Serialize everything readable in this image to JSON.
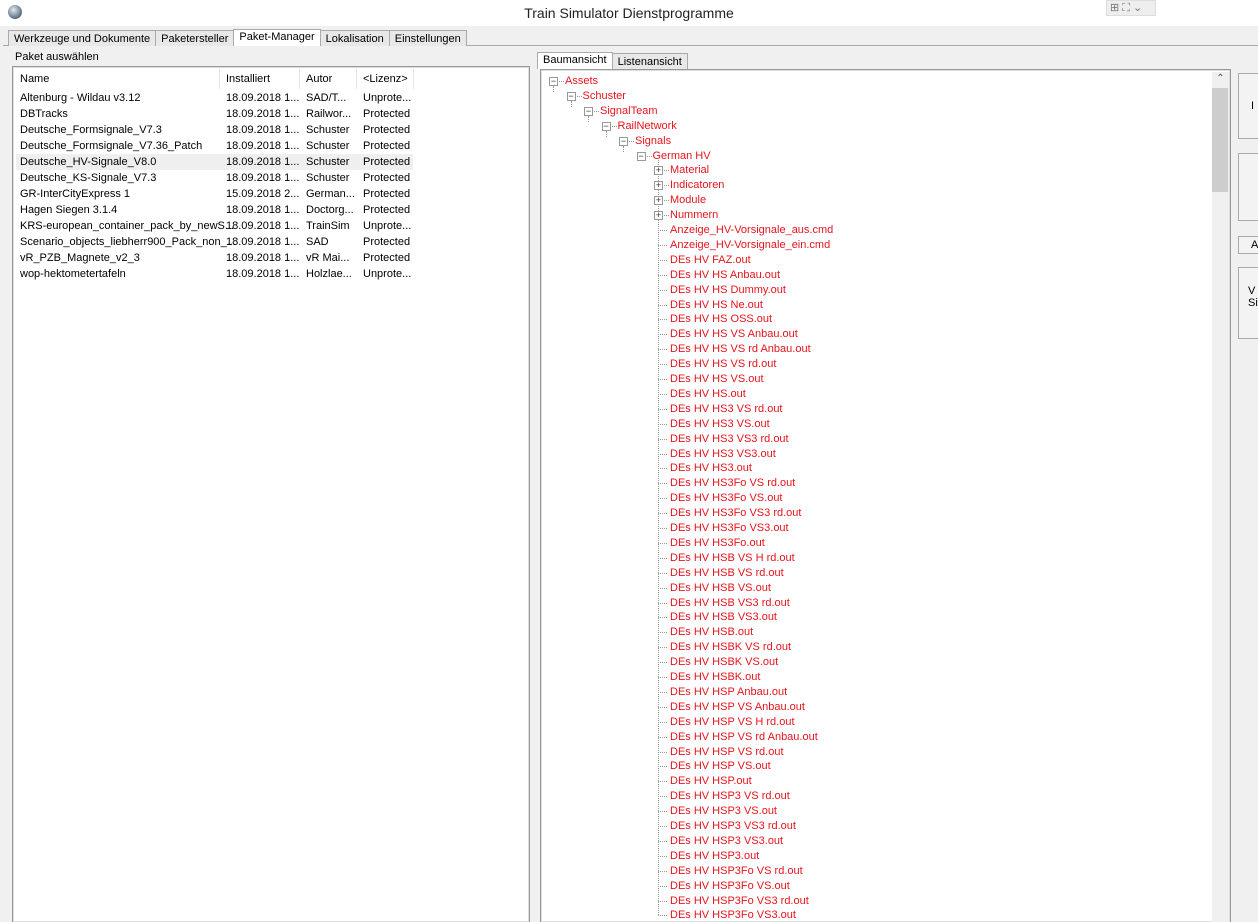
{
  "window": {
    "title": "Train Simulator Dienstprogramme",
    "controls": "⊞ ⛶ ⌄"
  },
  "tabs": [
    "Werkzeuge und Dokumente",
    "Paketersteller",
    "Paket-Manager",
    "Lokalisation",
    "Einstellungen"
  ],
  "active_tab": 2,
  "package_panel": {
    "label": "Paket auswählen",
    "columns": [
      "Name",
      "Installiert",
      "Autor",
      "<Lizenz>"
    ],
    "rows": [
      [
        "Altenburg - Wildau v3.12",
        "18.09.2018 1...",
        "SAD/T...",
        "Unprote..."
      ],
      [
        "DBTracks",
        "18.09.2018 1...",
        "Railwor...",
        "Protected"
      ],
      [
        "Deutsche_Formsignale_V7.3",
        "18.09.2018 1...",
        "Schuster",
        "Protected"
      ],
      [
        "Deutsche_Formsignale_V7.36_Patch",
        "18.09.2018 1...",
        "Schuster",
        "Protected"
      ],
      [
        "Deutsche_HV-Signale_V8.0",
        "18.09.2018 1...",
        "Schuster",
        "Protected"
      ],
      [
        "Deutsche_KS-Signale_V7.3",
        "18.09.2018 1...",
        "Schuster",
        "Protected"
      ],
      [
        "GR-InterCityExpress 1",
        "15.09.2018 2...",
        "German...",
        "Protected"
      ],
      [
        "Hagen Siegen 3.1.4",
        "18.09.2018 1...",
        "Doctorg...",
        "Protected"
      ],
      [
        "KRS-european_container_pack_by_newS...",
        "18.09.2018 1...",
        "TrainSim",
        "Unprote..."
      ],
      [
        "Scenario_objects_liebherr900_Pack_non_...",
        "18.09.2018 1...",
        "SAD",
        "Protected"
      ],
      [
        "vR_PZB_Magnete_v2_3",
        "18.09.2018 1...",
        "vR Mai...",
        "Protected"
      ],
      [
        "wop-hektometertafeln",
        "18.09.2018 1...",
        "Holzlae...",
        "Unprote..."
      ]
    ],
    "selected_row": 4
  },
  "view_tabs": [
    "Baumansicht",
    "Listenansicht"
  ],
  "tree": {
    "path": [
      "Assets",
      "Schuster",
      "SignalTeam",
      "RailNetwork",
      "Signals",
      "German HV"
    ],
    "folders": [
      "Material",
      "Indicatoren",
      "Module",
      "Nummern"
    ],
    "files": [
      "Anzeige_HV-Vorsignale_aus.cmd",
      "Anzeige_HV-Vorsignale_ein.cmd",
      "DEs HV FAZ.out",
      "DEs HV HS Anbau.out",
      "DEs HV HS Dummy.out",
      "DEs HV HS Ne.out",
      "DEs HV HS OSS.out",
      "DEs HV HS VS Anbau.out",
      "DEs HV HS VS rd Anbau.out",
      "DEs HV HS VS rd.out",
      "DEs HV HS VS.out",
      "DEs HV HS.out",
      "DEs HV HS3 VS rd.out",
      "DEs HV HS3 VS.out",
      "DEs HV HS3 VS3 rd.out",
      "DEs HV HS3 VS3.out",
      "DEs HV HS3.out",
      "DEs HV HS3Fo VS rd.out",
      "DEs HV HS3Fo VS.out",
      "DEs HV HS3Fo VS3 rd.out",
      "DEs HV HS3Fo VS3.out",
      "DEs HV HS3Fo.out",
      "DEs HV HSB VS H rd.out",
      "DEs HV HSB VS rd.out",
      "DEs HV HSB VS.out",
      "DEs HV HSB VS3 rd.out",
      "DEs HV HSB VS3.out",
      "DEs HV HSB.out",
      "DEs HV HSBK VS rd.out",
      "DEs HV HSBK VS.out",
      "DEs HV HSBK.out",
      "DEs HV HSP Anbau.out",
      "DEs HV HSP VS Anbau.out",
      "DEs HV HSP VS H rd.out",
      "DEs HV HSP VS rd Anbau.out",
      "DEs HV HSP VS rd.out",
      "DEs HV HSP VS.out",
      "DEs HV HSP.out",
      "DEs HV HSP3 VS rd.out",
      "DEs HV HSP3 VS.out",
      "DEs HV HSP3 VS3 rd.out",
      "DEs HV HSP3 VS3.out",
      "DEs HV HSP3.out",
      "DEs HV HSP3Fo VS rd.out",
      "DEs HV HSP3Fo VS.out",
      "DEs HV HSP3Fo VS3 rd.out",
      "DEs HV HSP3Fo VS3.out"
    ]
  },
  "side_buttons": [
    "I",
    "",
    "A",
    "V\nSi"
  ],
  "colors": {
    "tree_text": "#e8141c"
  }
}
